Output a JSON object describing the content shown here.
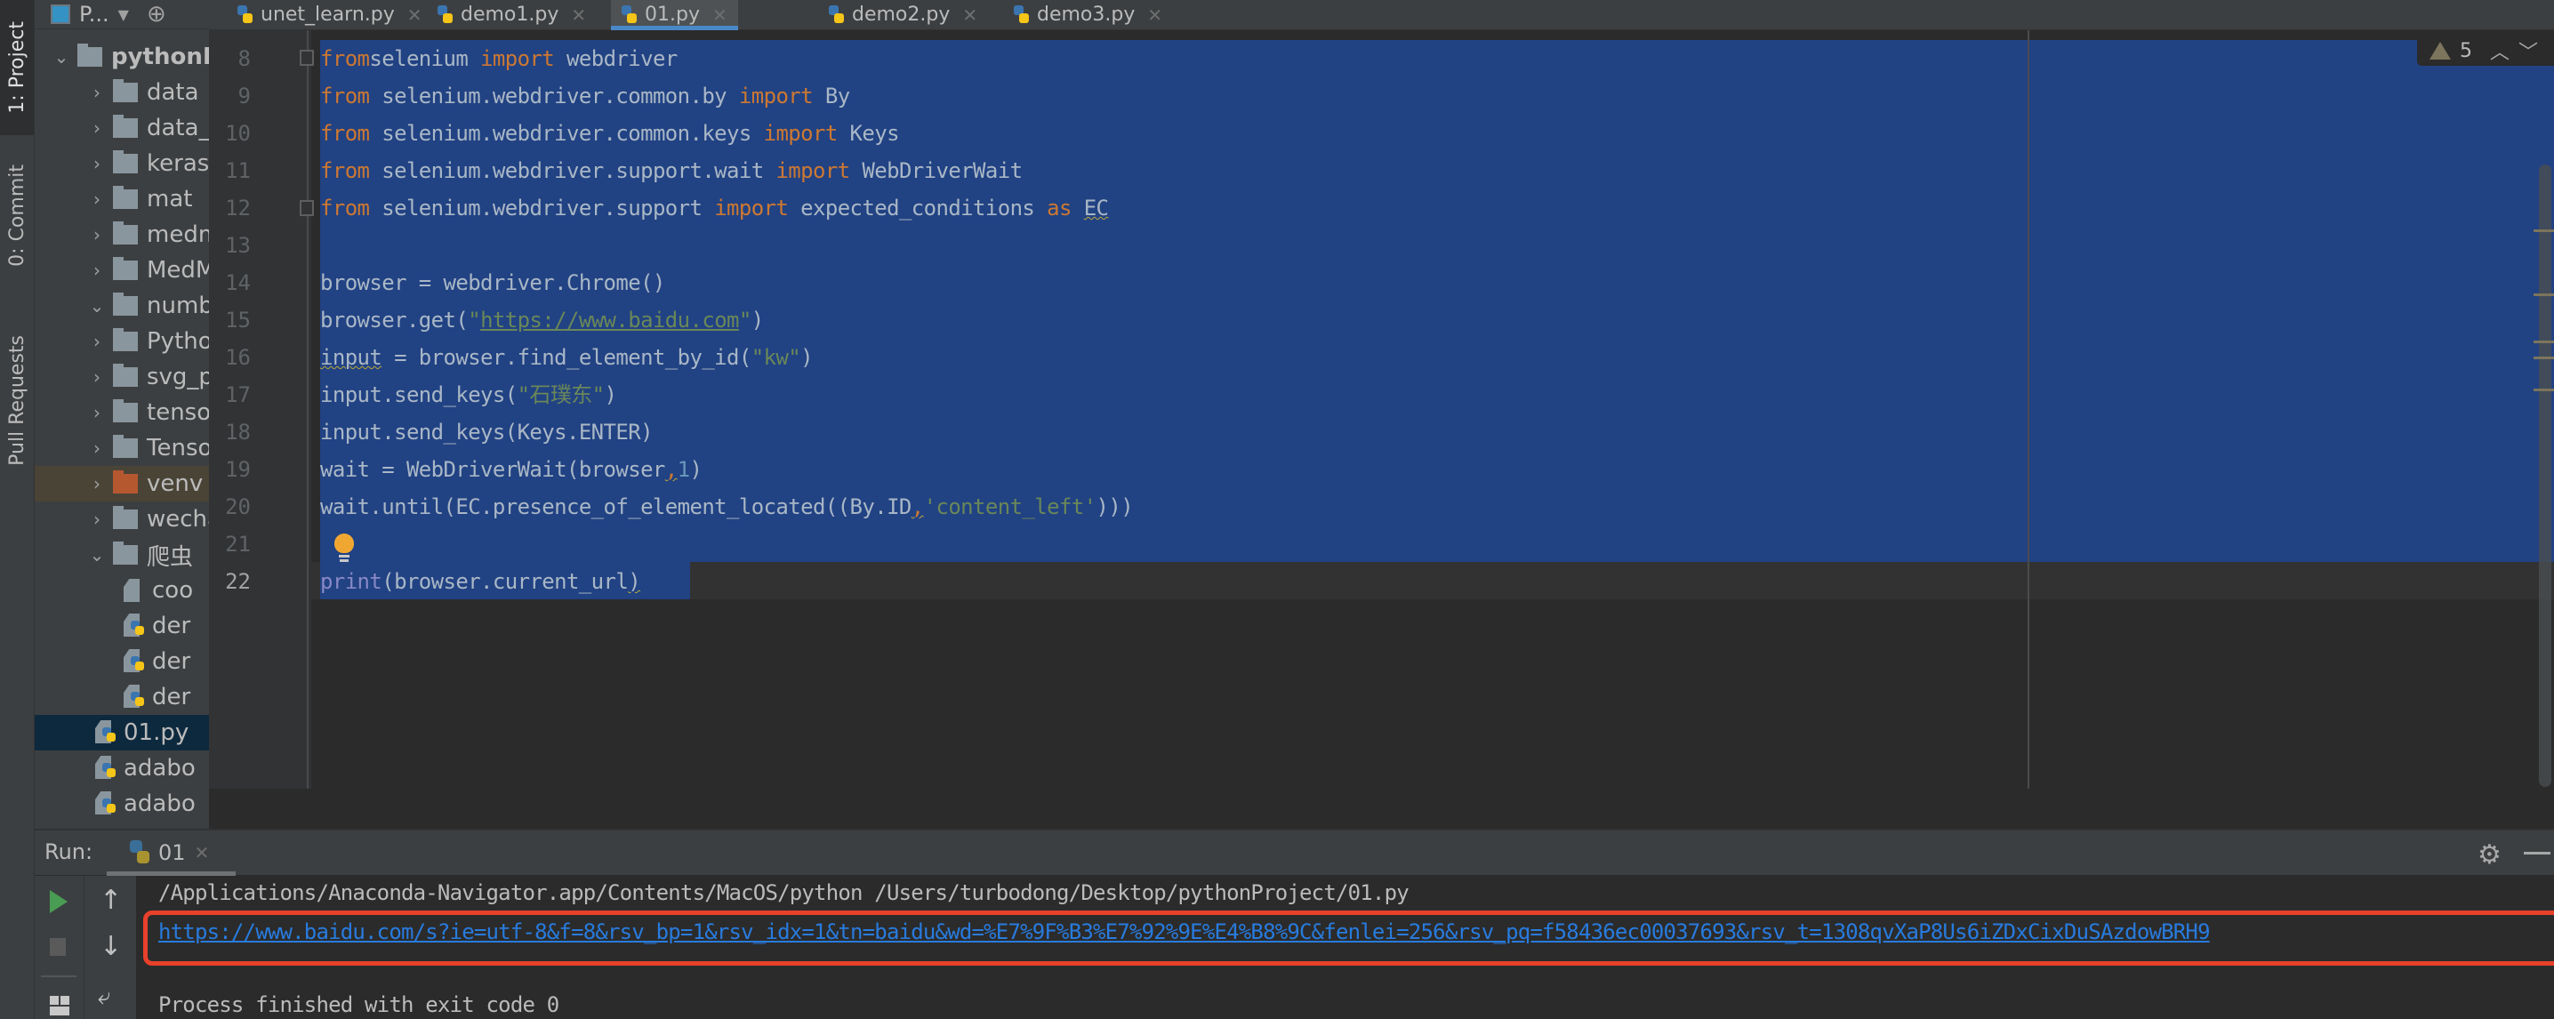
{
  "left_stripe": {
    "tabs": [
      {
        "label": "1: Project",
        "icon": "folder-icon"
      },
      {
        "label": "0: Commit",
        "icon": "commit-icon"
      },
      {
        "label": "Pull Requests",
        "icon": "pull-request-icon"
      }
    ]
  },
  "project_panel": {
    "title": "P...",
    "tree": [
      {
        "label": "pythonP",
        "type": "folder",
        "expanded": true,
        "depth": 0
      },
      {
        "label": "data",
        "type": "folder",
        "expanded": false,
        "depth": 1
      },
      {
        "label": "data_a",
        "type": "folder",
        "expanded": false,
        "depth": 1
      },
      {
        "label": "keras-",
        "type": "folder",
        "expanded": false,
        "depth": 1
      },
      {
        "label": "mat",
        "type": "folder",
        "expanded": false,
        "depth": 1
      },
      {
        "label": "medm",
        "type": "folder",
        "expanded": false,
        "depth": 1
      },
      {
        "label": "MedM",
        "type": "folder",
        "expanded": false,
        "depth": 1
      },
      {
        "label": "numbe",
        "type": "folder",
        "expanded": true,
        "depth": 1
      },
      {
        "label": "Pytho",
        "type": "folder",
        "expanded": false,
        "depth": 1
      },
      {
        "label": "svg_p",
        "type": "folder",
        "expanded": false,
        "depth": 1
      },
      {
        "label": "tensor",
        "type": "folder",
        "expanded": false,
        "depth": 1
      },
      {
        "label": "Tenso",
        "type": "folder",
        "expanded": false,
        "depth": 1
      },
      {
        "label": "venv",
        "type": "folder-excluded",
        "expanded": false,
        "depth": 1
      },
      {
        "label": "wecha",
        "type": "folder",
        "expanded": false,
        "depth": 1
      },
      {
        "label": "爬虫",
        "type": "folder",
        "expanded": true,
        "depth": 1
      },
      {
        "label": "coo",
        "type": "text-file",
        "depth": 2
      },
      {
        "label": "der",
        "type": "python-file",
        "depth": 2
      },
      {
        "label": "der",
        "type": "python-file",
        "depth": 2
      },
      {
        "label": "der",
        "type": "python-file",
        "depth": 2
      },
      {
        "label": "01.py",
        "type": "python-file",
        "depth": 1,
        "selected": true
      },
      {
        "label": "adabo",
        "type": "python-file",
        "depth": 1
      },
      {
        "label": "adabo",
        "type": "python-file",
        "depth": 1
      }
    ]
  },
  "editor_tabs": [
    {
      "label": "unet_learn.py",
      "active": false
    },
    {
      "label": "demo1.py",
      "active": false
    },
    {
      "label": "01.py",
      "active": true
    },
    {
      "label": "demo2.py",
      "active": false
    },
    {
      "label": "demo3.py",
      "active": false
    }
  ],
  "editor": {
    "inspection": {
      "warning_count": "5"
    },
    "lines": [
      {
        "num": "8",
        "segments": [
          [
            "kw",
            "from"
          ],
          [
            "",
            "selenium "
          ],
          [
            "kw",
            "import"
          ],
          [
            "",
            " webdriver"
          ]
        ]
      },
      {
        "num": "9",
        "segments": [
          [
            "kw",
            "from"
          ],
          [
            "",
            " selenium.webdriver.common.by "
          ],
          [
            "kw",
            "import"
          ],
          [
            "",
            " By"
          ]
        ]
      },
      {
        "num": "10",
        "segments": [
          [
            "kw",
            "from"
          ],
          [
            "",
            " selenium.webdriver.common.keys "
          ],
          [
            "kw",
            "import"
          ],
          [
            "",
            " Keys"
          ]
        ]
      },
      {
        "num": "11",
        "segments": [
          [
            "kw",
            "from"
          ],
          [
            "",
            " selenium.webdriver.support.wait "
          ],
          [
            "kw",
            "import"
          ],
          [
            "",
            " WebDriverWait"
          ]
        ]
      },
      {
        "num": "12",
        "segments": [
          [
            "kw",
            "from"
          ],
          [
            "",
            " selenium.webdriver.support "
          ],
          [
            "kw",
            "import"
          ],
          [
            "",
            " expected_conditions "
          ],
          [
            "kw",
            "as"
          ],
          [
            "",
            " "
          ],
          [
            "warn-u",
            "EC"
          ]
        ]
      },
      {
        "num": "13",
        "segments": []
      },
      {
        "num": "14",
        "segments": [
          [
            "",
            "browser = webdriver.Chrome()"
          ]
        ]
      },
      {
        "num": "15",
        "segments": [
          [
            "",
            "browser.get("
          ],
          [
            "str",
            "\""
          ],
          [
            "str link",
            "https://www.baidu.com"
          ],
          [
            "str",
            "\""
          ],
          [
            "",
            ")"
          ]
        ]
      },
      {
        "num": "16",
        "segments": [
          [
            "warn-u",
            "input"
          ],
          [
            "",
            " = browser.find_element_by_id("
          ],
          [
            "str",
            "\"kw\""
          ],
          [
            "",
            ")"
          ]
        ]
      },
      {
        "num": "17",
        "segments": [
          [
            "",
            "input.send_keys("
          ],
          [
            "str",
            "\"石璞东\""
          ],
          [
            "",
            ")"
          ]
        ]
      },
      {
        "num": "18",
        "segments": [
          [
            "",
            "input.send_keys(Keys.ENTER)"
          ]
        ]
      },
      {
        "num": "19",
        "segments": [
          [
            "",
            "wait = WebDriverWait(browser"
          ],
          [
            "kw warn-u",
            ","
          ],
          [
            "num",
            "1"
          ],
          [
            "",
            ")"
          ]
        ]
      },
      {
        "num": "20",
        "segments": [
          [
            "",
            "wait.until(EC.presence_of_element_located((By.ID"
          ],
          [
            "kw warn-u",
            ","
          ],
          [
            "str",
            "'content_left'"
          ],
          [
            "",
            ")))"
          ]
        ]
      },
      {
        "num": "21",
        "segments": []
      },
      {
        "num": "22",
        "segments": [
          [
            "bi",
            "print"
          ],
          [
            "",
            "(browser.current_url"
          ],
          [
            "warn-u",
            ")"
          ]
        ],
        "current": true
      }
    ]
  },
  "run_panel": {
    "label": "Run:",
    "tab_name": "01",
    "output": {
      "command": "/Applications/Anaconda-Navigator.app/Contents/MacOS/python /Users/turbodong/Desktop/pythonProject/01.py",
      "url": "https://www.baidu.com/s?ie=utf-8&f=8&rsv_bp=1&rsv_idx=1&tn=baidu&wd=%E7%9F%B3%E7%92%9E%E4%B8%9C&fenlei=256&rsv_pq=f58436ec00037693&rsv_t=1308qvXaP8Us6iZDxCixDuSAzdowBRH9",
      "exit_message": "Process finished with exit code 0"
    },
    "highlight_color": "#e8412b"
  }
}
